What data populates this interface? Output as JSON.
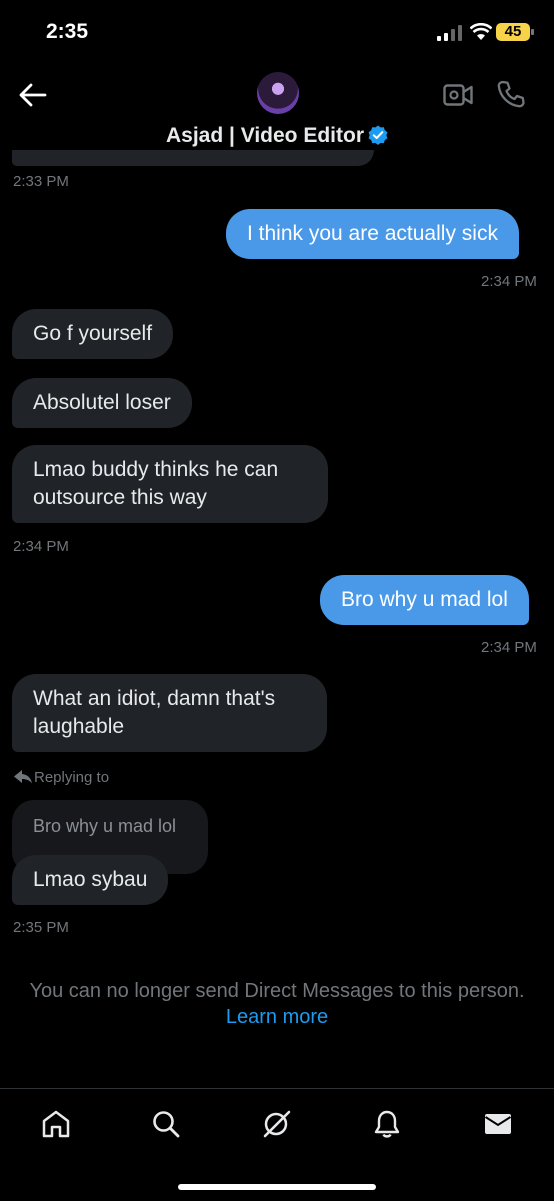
{
  "status_bar": {
    "time": "2:35",
    "battery": "45"
  },
  "header": {
    "contact_name": "Asjad | Video Editor"
  },
  "messages": [
    {
      "text": "I think you are actually sick"
    },
    {
      "text": "Go f yourself"
    },
    {
      "text": "Absolutel loser"
    },
    {
      "text": "Lmao buddy thinks he can outsource this way"
    },
    {
      "text": "Bro why u mad lol"
    },
    {
      "text": "What an idiot, damn that's laughable"
    },
    {
      "text": "Lmao sybau"
    }
  ],
  "timestamps": [
    "2:33 PM",
    "2:34 PM",
    "2:34 PM",
    "2:34 PM",
    "2:35 PM"
  ],
  "reply": {
    "label": "Replying to",
    "quoted": "Bro why u mad lol"
  },
  "notice": {
    "text": "You can no longer send Direct Messages to this person.",
    "link": "Learn more"
  },
  "icons": [
    "back-arrow-icon",
    "video-call-icon",
    "phone-icon",
    "home-icon",
    "search-icon",
    "grok-icon",
    "bell-icon",
    "mail-icon"
  ],
  "colors": {
    "accent": "#1d9bf0",
    "outgoing_bubble": "#4a99e9",
    "incoming_bubble": "#202327"
  }
}
